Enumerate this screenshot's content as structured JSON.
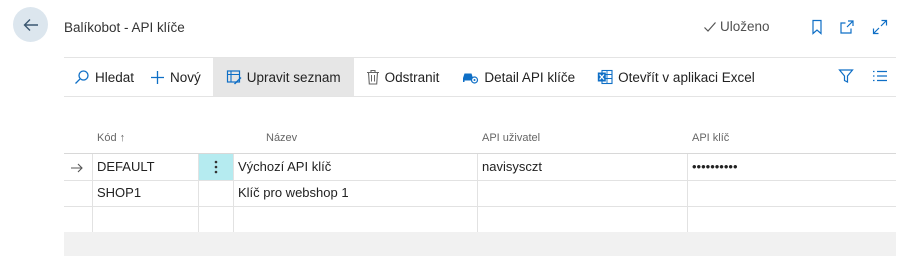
{
  "header": {
    "title": "Balíkobot - API klíče",
    "saved_label": "Uloženo"
  },
  "actions": [
    {
      "label": "Hledat",
      "icon": "search-icon"
    },
    {
      "label": "Nový",
      "icon": "plus-icon"
    },
    {
      "label": "Upravit seznam",
      "icon": "edit-list-icon",
      "active": true
    },
    {
      "label": "Odstranit",
      "icon": "trash-icon"
    },
    {
      "label": "Detail API klíče",
      "icon": "car-key-icon"
    },
    {
      "label": "Otevřít v aplikaci Excel",
      "icon": "excel-icon"
    }
  ],
  "columns": {
    "code": "Kód ↑",
    "name": "Název",
    "api_user": "API uživatel",
    "api_key": "API klíč"
  },
  "rows": [
    {
      "code": "DEFAULT",
      "name": "Výchozí API klíč",
      "api_user": "navisysczt",
      "api_key": "••••••••••",
      "selected": true
    },
    {
      "code": "SHOP1",
      "name": "Klíč pro webshop 1",
      "api_user": "",
      "api_key": ""
    },
    {
      "code": "",
      "name": "",
      "api_user": "",
      "api_key": ""
    }
  ],
  "colors": {
    "accent": "#0f6fc6",
    "row_menu_highlight": "#b5ebf0",
    "back_button_bg": "#dce6ee"
  }
}
